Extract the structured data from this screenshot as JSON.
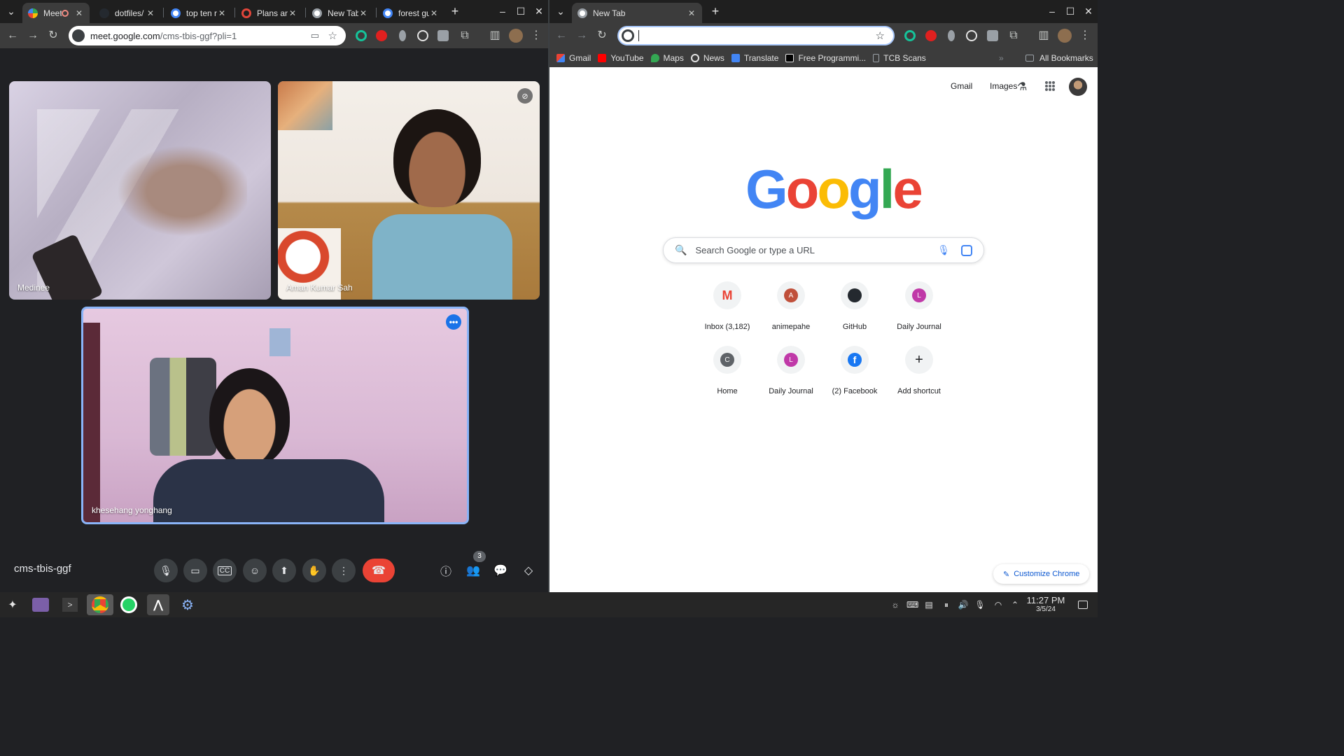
{
  "left_window": {
    "tabs": [
      {
        "title": "Meet",
        "active": true,
        "recording": true
      },
      {
        "title": "dotfiles/",
        "active": false
      },
      {
        "title": "top ten r",
        "active": false
      },
      {
        "title": "Plans an",
        "active": false
      },
      {
        "title": "New Tab",
        "active": false
      },
      {
        "title": "forest gu",
        "active": false
      }
    ],
    "address": {
      "host": "meet.google.com",
      "path": "/cms-tbis-ggf?pli=1"
    },
    "meet": {
      "participants": [
        {
          "name": "Medinee"
        },
        {
          "name": "Aman Kumar Sah",
          "muted": true
        },
        {
          "name": "khesehang yonghang",
          "speaking": true
        }
      ],
      "meeting_code": "cms-tbis-ggf",
      "people_count": "3"
    }
  },
  "right_window": {
    "tab": {
      "title": "New Tab"
    },
    "bookmarks": [
      "Gmail",
      "YouTube",
      "Maps",
      "News",
      "Translate",
      "Free Programmi...",
      "TCB Scans"
    ],
    "all_bookmarks": "All Bookmarks",
    "header_links": {
      "gmail": "Gmail",
      "images": "Images"
    },
    "logo": "Google",
    "search_placeholder": "Search Google or type a URL",
    "shortcuts": [
      {
        "label": "Inbox (3,182)",
        "icon": "gmail-icon"
      },
      {
        "label": "animepahe",
        "letter": "A",
        "color": "#c0503b"
      },
      {
        "label": "GitHub",
        "icon": "github-icon"
      },
      {
        "label": "Daily Journal",
        "letter": "L",
        "color": "#c039a8"
      },
      {
        "label": "Home",
        "letter": "C",
        "color": "#5f6368"
      },
      {
        "label": "Daily Journal",
        "letter": "L",
        "color": "#c039a8"
      },
      {
        "label": "(2) Facebook",
        "icon": "facebook-icon"
      },
      {
        "label": "Add shortcut",
        "icon": "plus-icon"
      }
    ],
    "customize": "Customize Chrome"
  },
  "taskbar": {
    "time": "11:27 PM",
    "date": "3/5/24"
  },
  "colors": {
    "google_blue": "#4285f4",
    "google_red": "#ea4335",
    "google_yellow": "#fbbc05",
    "google_green": "#34a853",
    "end_call": "#ea4335",
    "speaking_border": "#8ab4f8"
  }
}
